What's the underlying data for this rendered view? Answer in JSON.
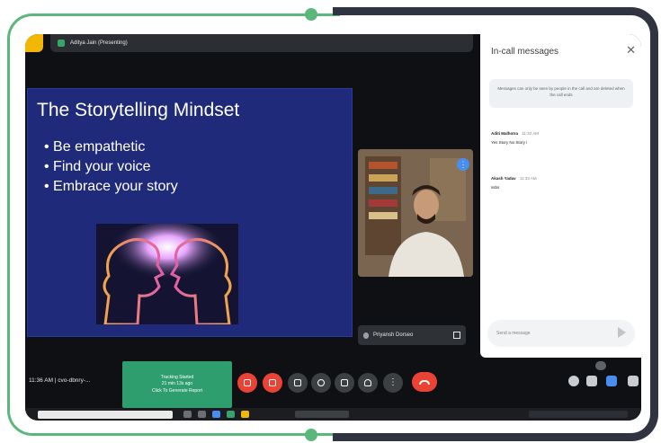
{
  "meeting": {
    "presenter_label": "Aditya Jain (Presenting)",
    "time_label": "11:36 AM",
    "meeting_code": "cvo-dbnry-..."
  },
  "slide": {
    "title": "The Storytelling Mindset",
    "bullets": [
      "Be empathetic",
      "Find your voice",
      "Embrace your story"
    ]
  },
  "participant_tile": {
    "name": "Priyansh Dorseo"
  },
  "chat_panel": {
    "title": "In-call messages",
    "close_icon": "✕",
    "notice": "Messages can only be seen by people in the call and are deleted when the call ends",
    "messages": [
      {
        "sender": "Aditi Malhotra",
        "time": "11:32 AM",
        "text": "Yes Story No Story !"
      },
      {
        "sender": "Akash Yadav",
        "time": "11:33 AM",
        "text": "ssbs"
      }
    ],
    "input_placeholder": "Send a message"
  },
  "tracking_popup": {
    "line1": "Tracking Started",
    "line2": "21 min 13s ago",
    "line3": "Click To Generate Report"
  },
  "colors": {
    "frame_green": "#5cb87a",
    "frame_dark": "#2f3440",
    "slide_bg": "#1f2a7a",
    "tracking_bg": "#2e9e6f",
    "end_call_red": "#ea4335"
  },
  "icons": {
    "controls": [
      "mic-off-icon",
      "camera-off-icon",
      "captions-icon",
      "emoji-icon",
      "present-icon",
      "raise-hand-icon",
      "more-options-icon",
      "end-call-icon"
    ],
    "right_controls": [
      "info-icon",
      "people-icon",
      "chat-icon",
      "activities-icon"
    ]
  }
}
